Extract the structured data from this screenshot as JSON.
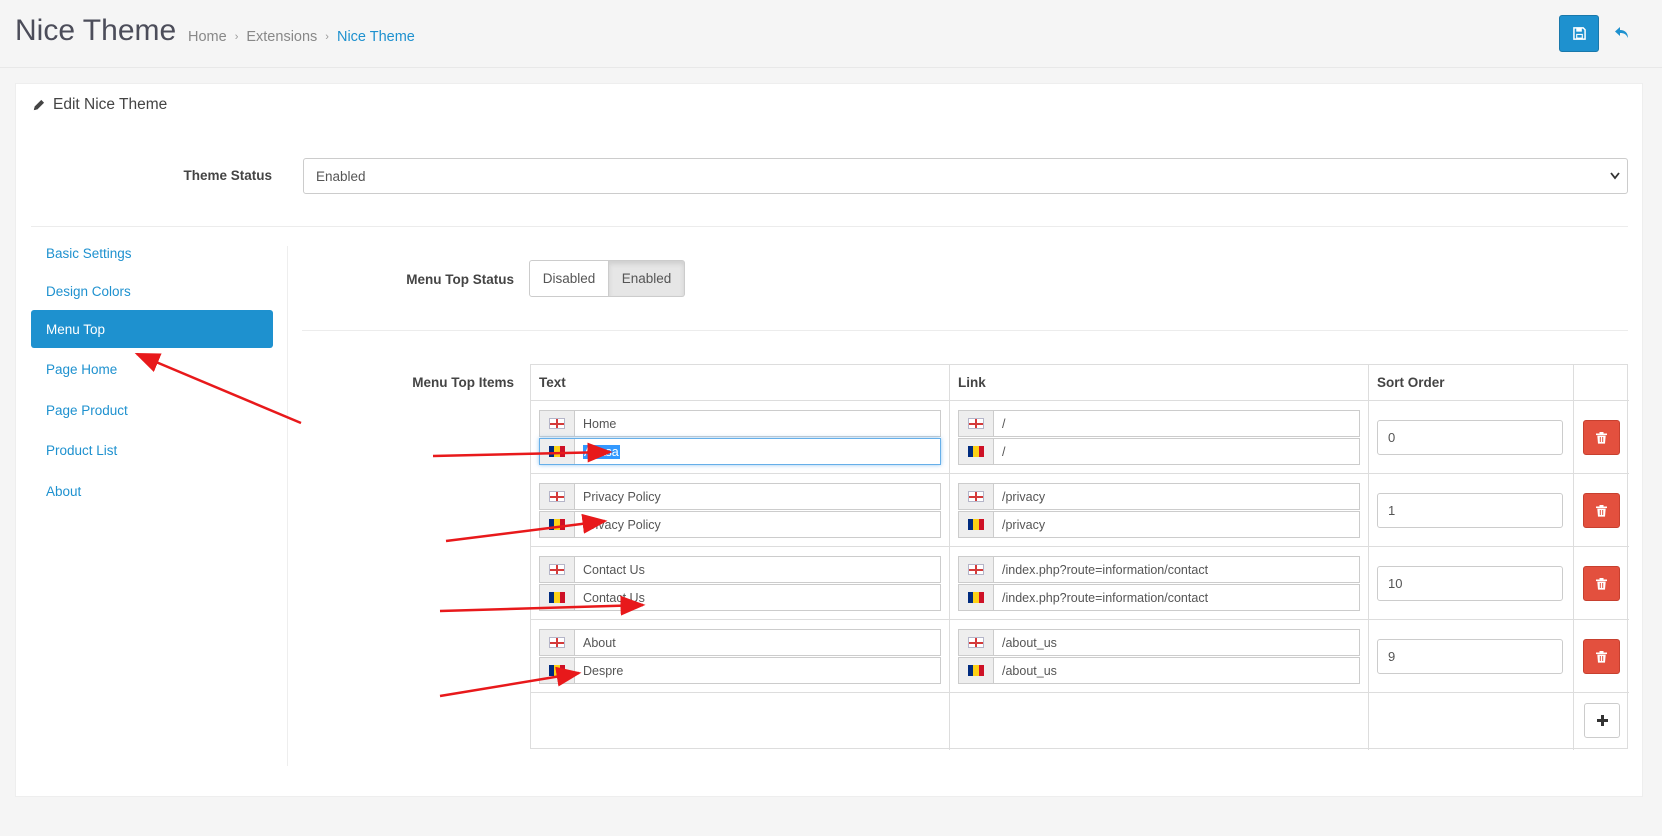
{
  "header": {
    "title": "Nice Theme",
    "breadcrumb": [
      "Home",
      "Extensions",
      "Nice Theme"
    ],
    "separator": "›"
  },
  "panel": {
    "heading": "Edit Nice Theme",
    "theme_status_label": "Theme Status",
    "theme_status_value": "Enabled"
  },
  "sidebar": {
    "items": [
      {
        "label": "Basic Settings"
      },
      {
        "label": "Design Colors"
      },
      {
        "label": "Menu Top",
        "active": true
      },
      {
        "label": "Page Home"
      },
      {
        "label": "Page Product"
      },
      {
        "label": "Product List"
      },
      {
        "label": "About"
      }
    ]
  },
  "menu_top": {
    "status_label": "Menu Top Status",
    "status_options": [
      "Disabled",
      "Enabled"
    ],
    "status_selected": "Enabled",
    "items_label": "Menu Top Items",
    "columns": [
      "Text",
      "Link",
      "Sort Order"
    ],
    "rows": [
      {
        "text_en": "Home",
        "text_ro": "Acasa",
        "link_en": "/",
        "link_ro": "/",
        "sort": "0"
      },
      {
        "text_en": "Privacy Policy",
        "text_ro": "Privacy Policy",
        "link_en": "/privacy",
        "link_ro": "/privacy",
        "sort": "1"
      },
      {
        "text_en": "Contact Us",
        "text_ro": "Contact Us",
        "link_en": "/index.php?route=information/contact",
        "link_ro": "/index.php?route=information/contact",
        "sort": "10"
      },
      {
        "text_en": "About",
        "text_ro": "Despre",
        "link_en": "/about_us",
        "link_ro": "/about_us",
        "sort": "9"
      }
    ]
  },
  "colors": {
    "primary": "#1e91cf",
    "danger": "#e3503e",
    "annotation": "#e8191b"
  },
  "icons": [
    "save-icon",
    "reply-icon",
    "pencil-icon",
    "trash-icon",
    "plus-icon",
    "chevron-down-icon",
    "flag-uk-icon",
    "flag-ro-icon"
  ]
}
